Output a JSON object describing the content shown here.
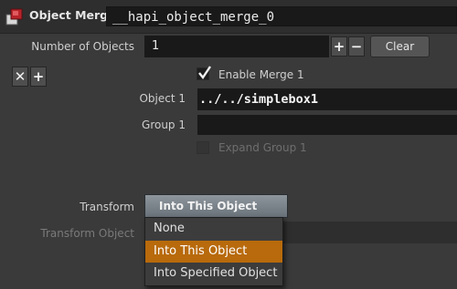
{
  "header": {
    "node_type": "Object Merge",
    "node_name": "__hapi_object_merge_0"
  },
  "num_objects": {
    "label": "Number of Objects",
    "value": "1",
    "add_glyph": "+",
    "remove_glyph": "−",
    "clear_label": "Clear"
  },
  "multiparm": {
    "remove_glyph": "✕",
    "add_glyph": "+"
  },
  "enable_merge": {
    "label": "Enable Merge 1",
    "checked": true
  },
  "object": {
    "label": "Object 1",
    "value": "../../simplebox1"
  },
  "group": {
    "label": "Group 1",
    "value": ""
  },
  "expand_group": {
    "label": "Expand Group 1",
    "checked": false
  },
  "transform": {
    "label": "Transform",
    "selected": "Into This Object",
    "options": [
      "None",
      "Into This Object",
      "Into Specified Object"
    ],
    "highlighted_index": 1
  },
  "transform_object": {
    "label": "Transform Object"
  },
  "colors": {
    "background": "#3a3a3a",
    "field": "#191919",
    "highlight": "#b86a0c"
  }
}
